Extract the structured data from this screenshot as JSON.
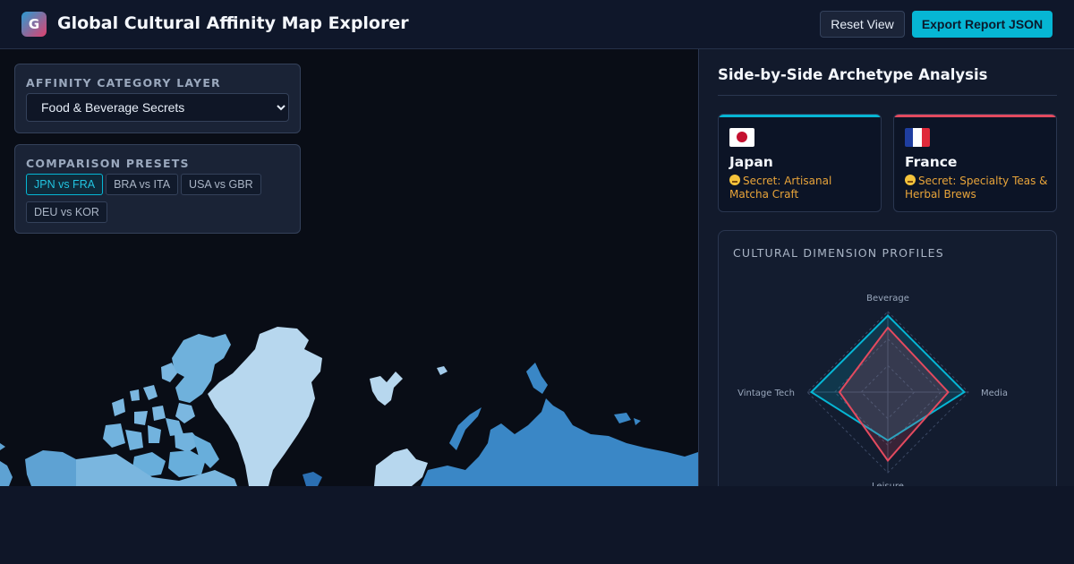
{
  "header": {
    "logo_letter": "G",
    "title": "Global Cultural Affinity Map Explorer",
    "reset_label": "Reset View",
    "export_label": "Export Report JSON"
  },
  "layer_panel": {
    "heading": "AFFINITY CATEGORY LAYER",
    "selected": "Food & Beverage Secrets"
  },
  "presets_panel": {
    "heading": "COMPARISON PRESETS",
    "items": [
      {
        "label": "JPN vs FRA",
        "active": true
      },
      {
        "label": "BRA vs ITA",
        "active": false
      },
      {
        "label": "USA vs GBR",
        "active": false
      },
      {
        "label": "DEU vs KOR",
        "active": false
      }
    ]
  },
  "side": {
    "title": "Side-by-Side Archetype Analysis",
    "country_a": {
      "name": "Japan",
      "flag": "japan-flag",
      "secret": "Secret: Artisanal Matcha Craft",
      "color": "#06b6d4"
    },
    "country_b": {
      "name": "France",
      "flag": "france-flag",
      "secret": "Secret: Specialty Teas & Herbal Brews",
      "color": "#e34a5f"
    },
    "chart_heading": "CULTURAL DIMENSION PROFILES"
  },
  "chart_data": {
    "type": "radar",
    "axes": [
      "Beverage",
      "Media",
      "Leisure",
      "Vintage Tech"
    ],
    "series": [
      {
        "name": "Japan",
        "values": [
          0.95,
          0.95,
          0.6,
          0.95
        ],
        "color": "#06b6d4"
      },
      {
        "name": "France",
        "values": [
          0.8,
          0.75,
          0.85,
          0.6
        ],
        "color": "#e34a5f"
      }
    ],
    "range": [
      0,
      1
    ]
  },
  "colors": {
    "accent": "#06b6d4",
    "secondary": "#e34a5f",
    "warning_text": "#e8a43a"
  }
}
